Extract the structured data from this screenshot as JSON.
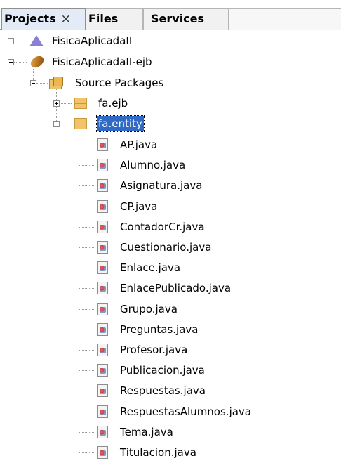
{
  "tabs": [
    {
      "label": "Projects",
      "close": "×",
      "active": true
    },
    {
      "label": "Files",
      "active": false
    },
    {
      "label": "Services",
      "active": false
    }
  ],
  "tree": {
    "project1": {
      "label": "FisicaAplicadaII",
      "icon": "web-project-icon"
    },
    "project2": {
      "label": "FisicaAplicadaII-ejb",
      "icon": "ejb-project-icon"
    },
    "source_packages": {
      "label": "Source Packages",
      "icon": "source-packages-icon"
    },
    "pkg_ejb": {
      "label": "fa.ejb",
      "icon": "package-icon"
    },
    "pkg_entity": {
      "label": "fa.entity",
      "icon": "package-icon",
      "selected": true
    },
    "files": [
      "AP.java",
      "Alumno.java",
      "Asignatura.java",
      "CP.java",
      "ContadorCr.java",
      "Cuestionario.java",
      "Enlace.java",
      "EnlacePublicado.java",
      "Grupo.java",
      "Preguntas.java",
      "Profesor.java",
      "Publicacion.java",
      "Respuestas.java",
      "RespuestasAlumnos.java",
      "Tema.java",
      "Titulacion.java"
    ]
  },
  "colors": {
    "selection": "#316ac5",
    "tab_active": "#e3ebf6"
  }
}
